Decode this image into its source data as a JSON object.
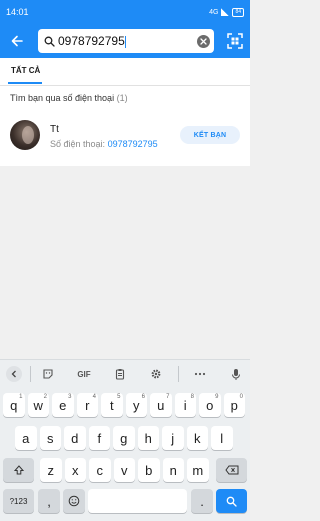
{
  "status_bar": {
    "time": "14:01",
    "network": "4G",
    "battery": "84"
  },
  "search": {
    "query": "0978792795"
  },
  "tabs": [
    {
      "label": "TẤT CẢ",
      "active": true
    }
  ],
  "results": {
    "section_title": "Tìm bạn qua số điện thoại",
    "section_count": "(1)",
    "contact": {
      "name": "Tt",
      "phone_label": "Số điện thoại:",
      "phone": "0978792795",
      "action": "KẾT BẠN"
    }
  },
  "keyboard": {
    "toolbar": {
      "gif_label": "GIF"
    },
    "row1": [
      {
        "key": "q",
        "num": "1"
      },
      {
        "key": "w",
        "num": "2"
      },
      {
        "key": "e",
        "num": "3"
      },
      {
        "key": "r",
        "num": "4"
      },
      {
        "key": "t",
        "num": "5"
      },
      {
        "key": "y",
        "num": "6"
      },
      {
        "key": "u",
        "num": "7"
      },
      {
        "key": "i",
        "num": "8"
      },
      {
        "key": "o",
        "num": "9"
      },
      {
        "key": "p",
        "num": "0"
      }
    ],
    "row2": [
      "a",
      "s",
      "d",
      "f",
      "g",
      "h",
      "j",
      "k",
      "l"
    ],
    "row3": [
      "z",
      "x",
      "c",
      "v",
      "b",
      "n",
      "m"
    ],
    "bottom": {
      "symbols": "?123",
      "comma": ",",
      "period": "."
    }
  },
  "colors": {
    "accent": "#1e8bf6",
    "background": "#f0f0f0",
    "keyboard": "#eceff1"
  }
}
